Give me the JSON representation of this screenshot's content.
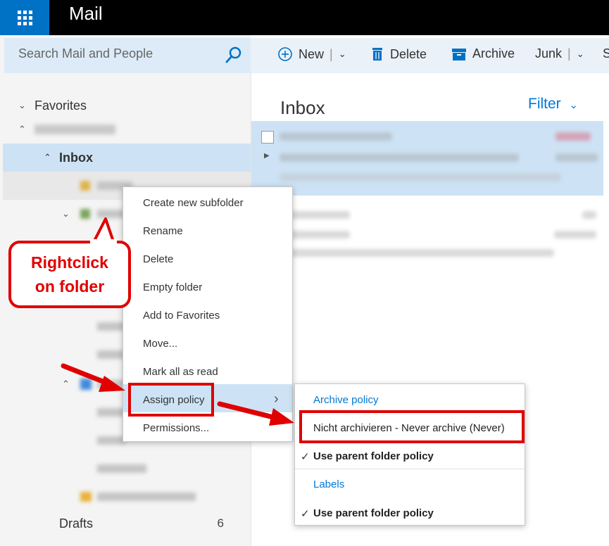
{
  "app": {
    "title": "Mail"
  },
  "search": {
    "placeholder": "Search Mail and People"
  },
  "toolbar": {
    "new_label": "New",
    "delete_label": "Delete",
    "archive_label": "Archive",
    "junk_label": "Junk",
    "more_label": "S"
  },
  "sidebar": {
    "favorites_label": "Favorites",
    "inbox_label": "Inbox",
    "drafts_label": "Drafts",
    "drafts_count": "6"
  },
  "list": {
    "title": "Inbox",
    "filter_label": "Filter"
  },
  "context_menu": {
    "items": [
      "Create new subfolder",
      "Rename",
      "Delete",
      "Empty folder",
      "Add to Favorites",
      "Move...",
      "Mark all as read",
      "Assign policy",
      "Permissions..."
    ]
  },
  "submenu": {
    "archive_header": "Archive policy",
    "never_archive": "Nicht archivieren - Never archive (Never)",
    "use_parent_1": "Use parent folder policy",
    "labels_header": "Labels",
    "use_parent_2": "Use parent folder policy"
  },
  "annotation": {
    "line1": "Rightclick",
    "line2": "on folder"
  },
  "colors": {
    "accent": "#0072c6",
    "highlight": "#cde3f5",
    "annotation_red": "#e00000"
  }
}
